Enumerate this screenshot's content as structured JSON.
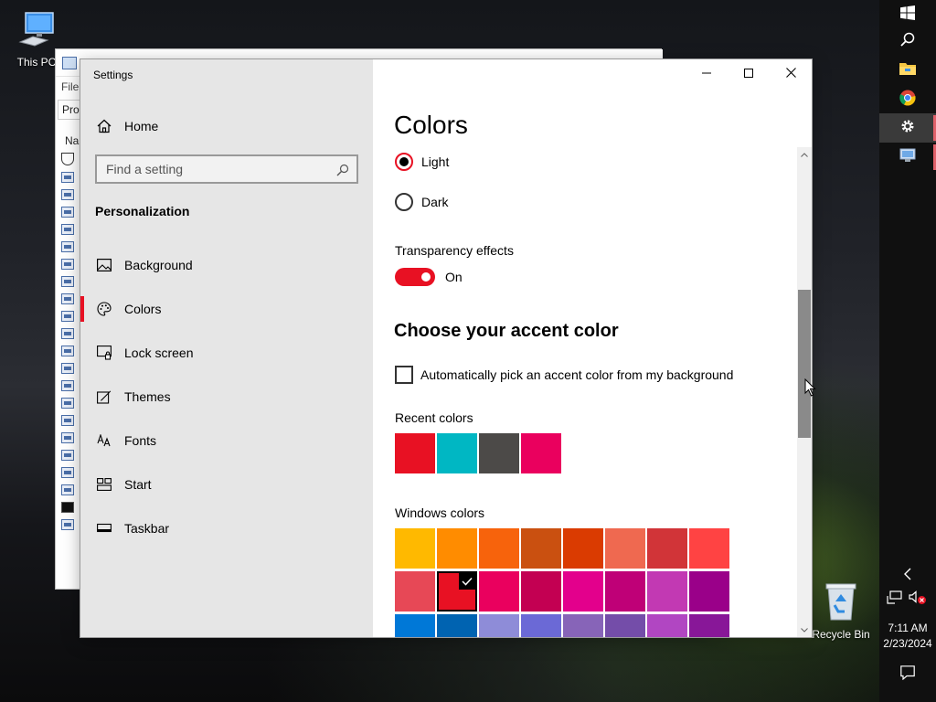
{
  "desktop": {
    "icons": [
      {
        "label": "This PC",
        "icon": "computer-icon"
      },
      {
        "label": "Recycle Bin",
        "icon": "recycle-bin-icon"
      }
    ]
  },
  "explorer": {
    "menu_file": "File",
    "address_partial": "Pro",
    "column_name_partial": "Na"
  },
  "settings": {
    "window_title": "Settings",
    "nav": {
      "home": "Home",
      "search_placeholder": "Find a setting",
      "section": "Personalization",
      "items": [
        {
          "label": "Background",
          "icon": "picture-icon"
        },
        {
          "label": "Colors",
          "icon": "palette-icon",
          "selected": true
        },
        {
          "label": "Lock screen",
          "icon": "lock-screen-icon"
        },
        {
          "label": "Themes",
          "icon": "themes-icon"
        },
        {
          "label": "Fonts",
          "icon": "fonts-icon"
        },
        {
          "label": "Start",
          "icon": "start-icon"
        },
        {
          "label": "Taskbar",
          "icon": "taskbar-icon"
        }
      ]
    },
    "content": {
      "title": "Colors",
      "mode_options": [
        {
          "label": "Light",
          "selected": true
        },
        {
          "label": "Dark",
          "selected": false
        }
      ],
      "transparency_label": "Transparency effects",
      "transparency_state": "On",
      "accent_heading": "Choose your accent color",
      "auto_accent_label": "Automatically pick an accent color from my background",
      "recent_colors_label": "Recent colors",
      "recent_colors": [
        "#e81123",
        "#00b7c3",
        "#4c4a48",
        "#ea005e"
      ],
      "windows_colors_label": "Windows colors",
      "windows_colors": [
        "#ffb900",
        "#ff8c00",
        "#f7630c",
        "#ca5010",
        "#da3b01",
        "#ef6950",
        "#d13438",
        "#ff4343",
        "#e74856",
        "#e81123",
        "#ea005e",
        "#c30052",
        "#e3008c",
        "#bf0077",
        "#c239b3",
        "#9a0089",
        "#0078d7",
        "#0063b1",
        "#8e8cd8",
        "#6b69d6",
        "#8764b8",
        "#744da9",
        "#b146c2",
        "#881798"
      ],
      "selected_windows_color_index": 9
    }
  },
  "taskbar": {
    "time": "7:11 AM",
    "date": "2/23/2024",
    "buttons": [
      "windows-logo-icon",
      "search-icon",
      "file-explorer-icon",
      "chrome-icon",
      "settings-gear-icon",
      "remote-desktop-icon"
    ]
  },
  "colors": {
    "accent": "#e81123"
  }
}
